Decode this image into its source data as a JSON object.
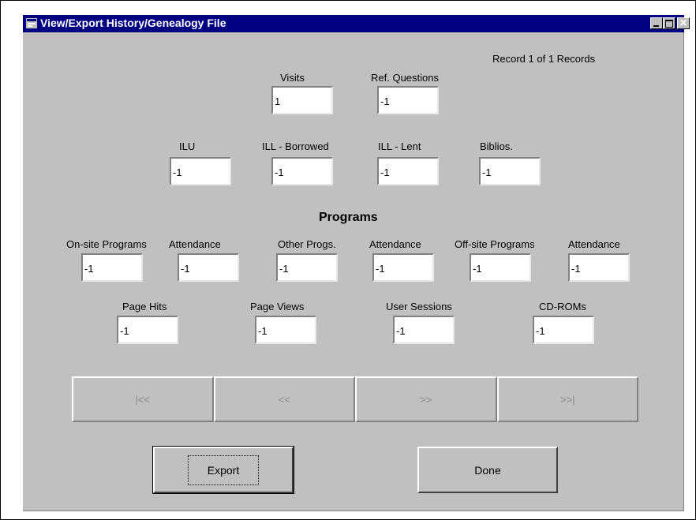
{
  "window": {
    "title": "View/Export History/Genealogy File",
    "icons": {
      "app": "form-icon",
      "minimize": "minimize-icon",
      "maximize": "maximize-icon",
      "close": "close-icon"
    }
  },
  "record_status": "Record 1 of 1 Records",
  "fields": {
    "visits": {
      "label": "Visits",
      "value": "1"
    },
    "ref_questions": {
      "label": "Ref. Questions",
      "value": "-1"
    },
    "ilu": {
      "label": "ILU",
      "value": "-1"
    },
    "ill_borrowed": {
      "label": "ILL - Borrowed",
      "value": "-1"
    },
    "ill_lent": {
      "label": "ILL - Lent",
      "value": "-1"
    },
    "biblios": {
      "label": "Biblios.",
      "value": "-1"
    },
    "onsite_programs": {
      "label": "On-site Programs",
      "value": "-1"
    },
    "onsite_attendance": {
      "label": "Attendance",
      "value": "-1"
    },
    "other_progs": {
      "label": "Other Progs.",
      "value": "-1"
    },
    "other_attendance": {
      "label": "Attendance",
      "value": "-1"
    },
    "offsite_programs": {
      "label": "Off-site Programs",
      "value": "-1"
    },
    "offsite_attendance": {
      "label": "Attendance",
      "value": "-1"
    },
    "page_hits": {
      "label": "Page Hits",
      "value": "-1"
    },
    "page_views": {
      "label": "Page Views",
      "value": "-1"
    },
    "user_sessions": {
      "label": "User Sessions",
      "value": "-1"
    },
    "cd_roms": {
      "label": "CD-ROMs",
      "value": "-1"
    }
  },
  "programs_heading": "Programs",
  "navigation": {
    "first": "|<<",
    "previous": "<<",
    "next": ">>",
    "last": ">>|"
  },
  "buttons": {
    "export": "Export",
    "done": "Done"
  }
}
